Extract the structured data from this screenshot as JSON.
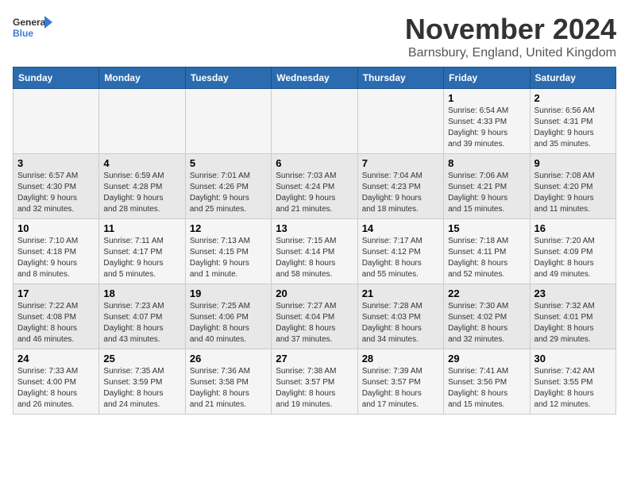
{
  "logo": {
    "general": "General",
    "blue": "Blue"
  },
  "header": {
    "month": "November 2024",
    "location": "Barnsbury, England, United Kingdom"
  },
  "weekdays": [
    "Sunday",
    "Monday",
    "Tuesday",
    "Wednesday",
    "Thursday",
    "Friday",
    "Saturday"
  ],
  "weeks": [
    [
      {
        "day": "",
        "info": ""
      },
      {
        "day": "",
        "info": ""
      },
      {
        "day": "",
        "info": ""
      },
      {
        "day": "",
        "info": ""
      },
      {
        "day": "",
        "info": ""
      },
      {
        "day": "1",
        "info": "Sunrise: 6:54 AM\nSunset: 4:33 PM\nDaylight: 9 hours\nand 39 minutes."
      },
      {
        "day": "2",
        "info": "Sunrise: 6:56 AM\nSunset: 4:31 PM\nDaylight: 9 hours\nand 35 minutes."
      }
    ],
    [
      {
        "day": "3",
        "info": "Sunrise: 6:57 AM\nSunset: 4:30 PM\nDaylight: 9 hours\nand 32 minutes."
      },
      {
        "day": "4",
        "info": "Sunrise: 6:59 AM\nSunset: 4:28 PM\nDaylight: 9 hours\nand 28 minutes."
      },
      {
        "day": "5",
        "info": "Sunrise: 7:01 AM\nSunset: 4:26 PM\nDaylight: 9 hours\nand 25 minutes."
      },
      {
        "day": "6",
        "info": "Sunrise: 7:03 AM\nSunset: 4:24 PM\nDaylight: 9 hours\nand 21 minutes."
      },
      {
        "day": "7",
        "info": "Sunrise: 7:04 AM\nSunset: 4:23 PM\nDaylight: 9 hours\nand 18 minutes."
      },
      {
        "day": "8",
        "info": "Sunrise: 7:06 AM\nSunset: 4:21 PM\nDaylight: 9 hours\nand 15 minutes."
      },
      {
        "day": "9",
        "info": "Sunrise: 7:08 AM\nSunset: 4:20 PM\nDaylight: 9 hours\nand 11 minutes."
      }
    ],
    [
      {
        "day": "10",
        "info": "Sunrise: 7:10 AM\nSunset: 4:18 PM\nDaylight: 9 hours\nand 8 minutes."
      },
      {
        "day": "11",
        "info": "Sunrise: 7:11 AM\nSunset: 4:17 PM\nDaylight: 9 hours\nand 5 minutes."
      },
      {
        "day": "12",
        "info": "Sunrise: 7:13 AM\nSunset: 4:15 PM\nDaylight: 9 hours\nand 1 minute."
      },
      {
        "day": "13",
        "info": "Sunrise: 7:15 AM\nSunset: 4:14 PM\nDaylight: 8 hours\nand 58 minutes."
      },
      {
        "day": "14",
        "info": "Sunrise: 7:17 AM\nSunset: 4:12 PM\nDaylight: 8 hours\nand 55 minutes."
      },
      {
        "day": "15",
        "info": "Sunrise: 7:18 AM\nSunset: 4:11 PM\nDaylight: 8 hours\nand 52 minutes."
      },
      {
        "day": "16",
        "info": "Sunrise: 7:20 AM\nSunset: 4:09 PM\nDaylight: 8 hours\nand 49 minutes."
      }
    ],
    [
      {
        "day": "17",
        "info": "Sunrise: 7:22 AM\nSunset: 4:08 PM\nDaylight: 8 hours\nand 46 minutes."
      },
      {
        "day": "18",
        "info": "Sunrise: 7:23 AM\nSunset: 4:07 PM\nDaylight: 8 hours\nand 43 minutes."
      },
      {
        "day": "19",
        "info": "Sunrise: 7:25 AM\nSunset: 4:06 PM\nDaylight: 8 hours\nand 40 minutes."
      },
      {
        "day": "20",
        "info": "Sunrise: 7:27 AM\nSunset: 4:04 PM\nDaylight: 8 hours\nand 37 minutes."
      },
      {
        "day": "21",
        "info": "Sunrise: 7:28 AM\nSunset: 4:03 PM\nDaylight: 8 hours\nand 34 minutes."
      },
      {
        "day": "22",
        "info": "Sunrise: 7:30 AM\nSunset: 4:02 PM\nDaylight: 8 hours\nand 32 minutes."
      },
      {
        "day": "23",
        "info": "Sunrise: 7:32 AM\nSunset: 4:01 PM\nDaylight: 8 hours\nand 29 minutes."
      }
    ],
    [
      {
        "day": "24",
        "info": "Sunrise: 7:33 AM\nSunset: 4:00 PM\nDaylight: 8 hours\nand 26 minutes."
      },
      {
        "day": "25",
        "info": "Sunrise: 7:35 AM\nSunset: 3:59 PM\nDaylight: 8 hours\nand 24 minutes."
      },
      {
        "day": "26",
        "info": "Sunrise: 7:36 AM\nSunset: 3:58 PM\nDaylight: 8 hours\nand 21 minutes."
      },
      {
        "day": "27",
        "info": "Sunrise: 7:38 AM\nSunset: 3:57 PM\nDaylight: 8 hours\nand 19 minutes."
      },
      {
        "day": "28",
        "info": "Sunrise: 7:39 AM\nSunset: 3:57 PM\nDaylight: 8 hours\nand 17 minutes."
      },
      {
        "day": "29",
        "info": "Sunrise: 7:41 AM\nSunset: 3:56 PM\nDaylight: 8 hours\nand 15 minutes."
      },
      {
        "day": "30",
        "info": "Sunrise: 7:42 AM\nSunset: 3:55 PM\nDaylight: 8 hours\nand 12 minutes."
      }
    ]
  ]
}
